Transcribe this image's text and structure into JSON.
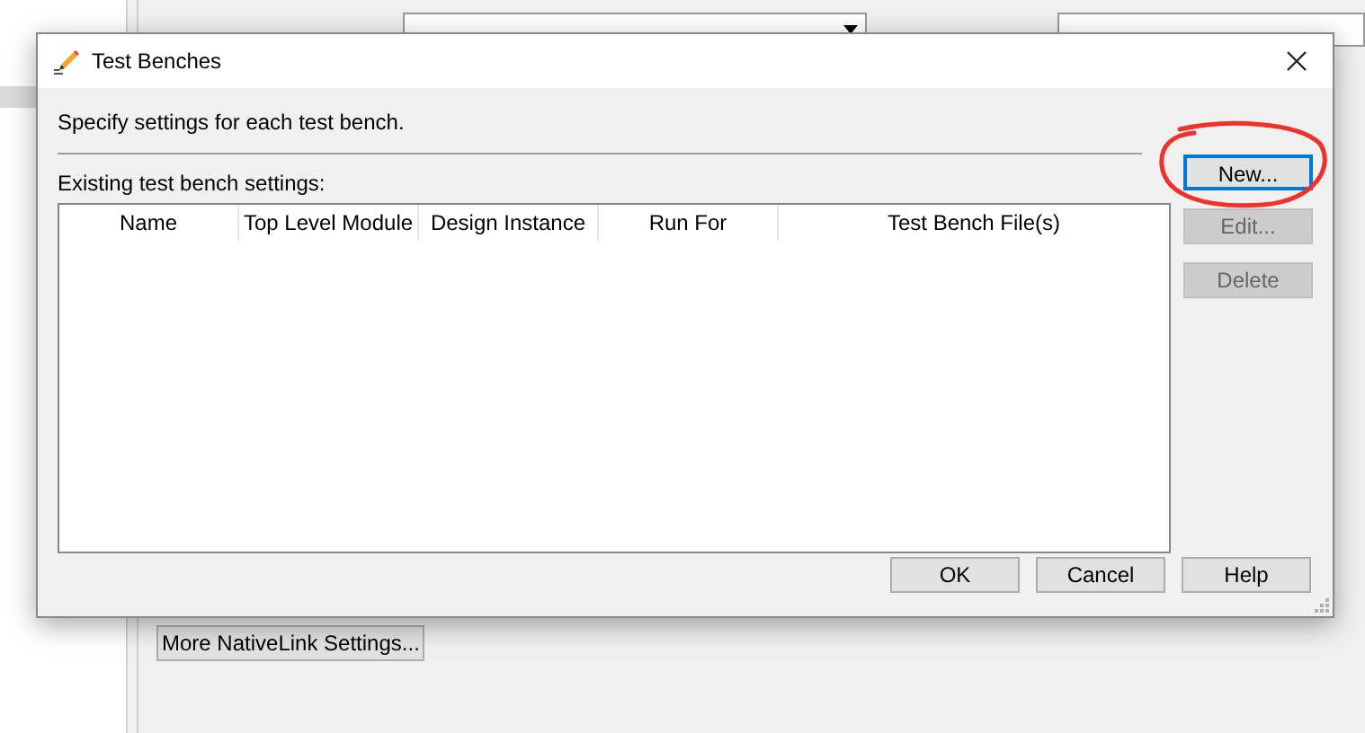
{
  "background": {
    "more_button": "More NativeLink Settings..."
  },
  "dialog": {
    "title": "Test Benches",
    "instruction": "Specify settings for each test bench.",
    "table_label": "Existing test bench settings:",
    "columns": [
      "Name",
      "Top Level Module",
      "Design Instance",
      "Run For",
      "Test Bench File(s)"
    ],
    "side_buttons": [
      {
        "label": "New...",
        "disabled": false,
        "focused": true
      },
      {
        "label": "Edit...",
        "disabled": true,
        "focused": false
      },
      {
        "label": "Delete",
        "disabled": true,
        "focused": false
      }
    ],
    "footer_buttons": [
      "OK",
      "Cancel",
      "Help"
    ]
  }
}
